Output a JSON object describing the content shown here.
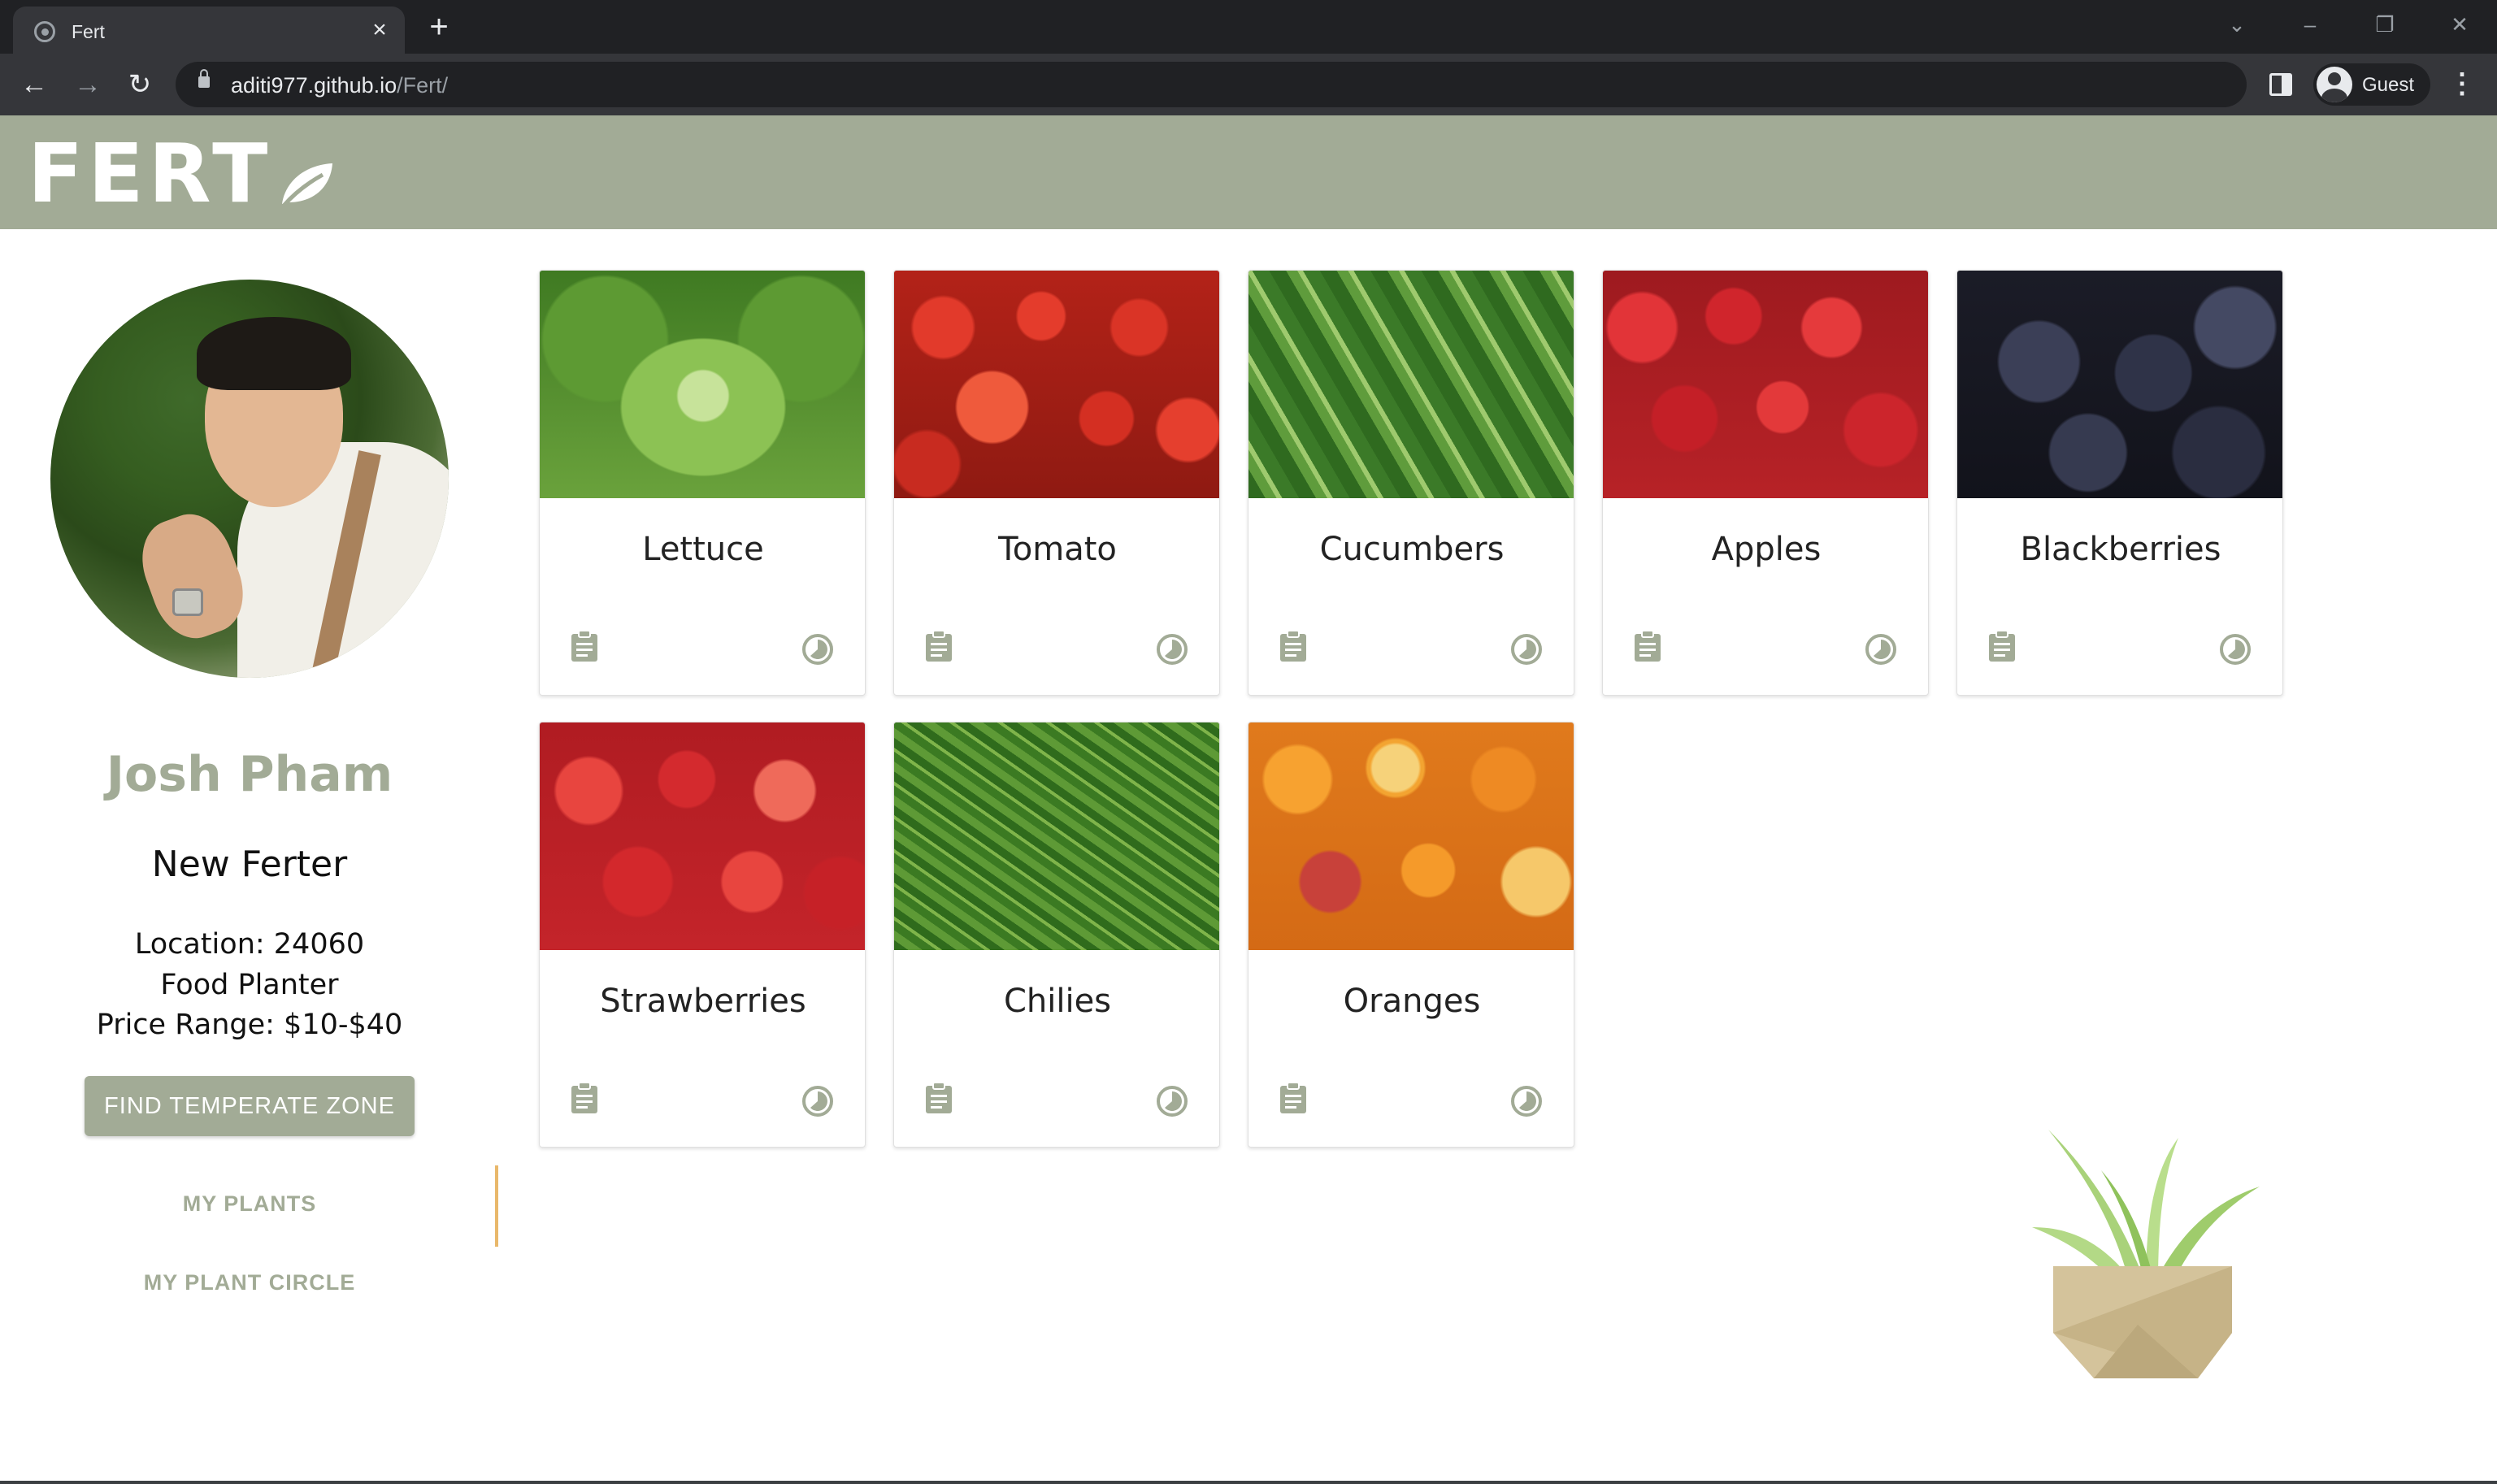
{
  "browser": {
    "tab_title": "Fert",
    "url_host": "aditi977.github.io",
    "url_path": "/Fert/",
    "profile_label": "Guest"
  },
  "app": {
    "logo_text": "FERT",
    "colors": {
      "brand": "#a2ab96",
      "accent": "#e9b86b"
    }
  },
  "profile": {
    "name": "Josh Pham",
    "rank": "New Ferter",
    "location": "Location: 24060",
    "planter_type": "Food Planter",
    "price_range": "Price Range: $10-$40",
    "find_button": "FIND TEMPERATE ZONE"
  },
  "sidebar": {
    "links": [
      {
        "label": "MY PLANTS",
        "active": true
      },
      {
        "label": "MY PLANT CIRCLE",
        "active": false
      }
    ]
  },
  "plants": [
    {
      "name": "Lettuce",
      "image": "lettuce"
    },
    {
      "name": "Tomato",
      "image": "tomato"
    },
    {
      "name": "Cucumbers",
      "image": "cucumber"
    },
    {
      "name": "Apples",
      "image": "apples"
    },
    {
      "name": "Blackberries",
      "image": "blackberries"
    },
    {
      "name": "Strawberries",
      "image": "strawberries"
    },
    {
      "name": "Chilies",
      "image": "chilies"
    },
    {
      "name": "Oranges",
      "image": "oranges"
    }
  ],
  "card_icons": {
    "left": "clipboard-icon",
    "right": "timer-icon"
  }
}
